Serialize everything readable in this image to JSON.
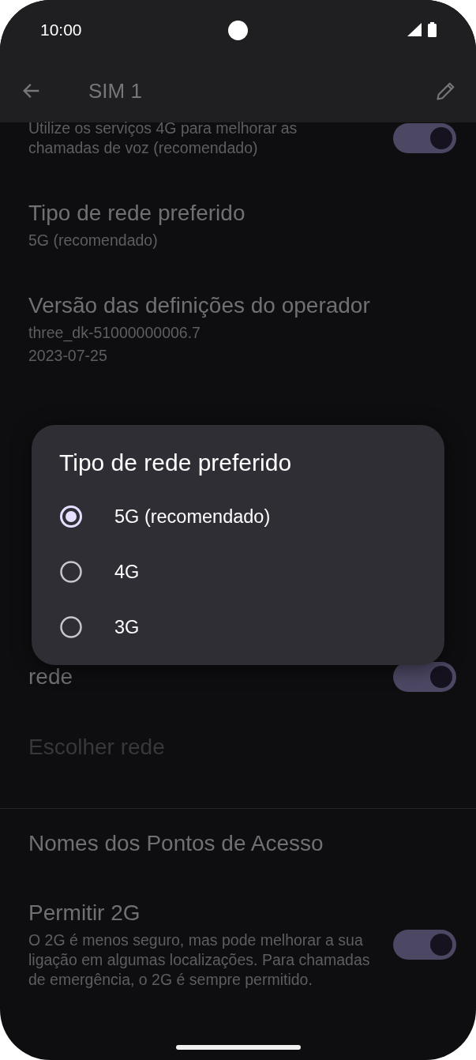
{
  "status_bar": {
    "time": "10:00"
  },
  "app_bar": {
    "title": "SIM 1"
  },
  "settings_above": [
    {
      "kind": "switch",
      "summary": [
        "Utilize os serviços 4G para melhorar as chamadas de voz (recomendado)"
      ],
      "on": true,
      "disabled": false
    },
    {
      "kind": "text",
      "title": "Tipo de rede preferido",
      "summary": [
        "5G (recomendado)"
      ],
      "disabled": false
    },
    {
      "kind": "text",
      "title": "Versão das definições do operador",
      "summary": [
        "three_dk-51000000006.7",
        "2023-07-25"
      ],
      "disabled": false
    }
  ],
  "settings_below": [
    {
      "kind": "switch",
      "title": "rede",
      "on": true,
      "disabled": false
    },
    {
      "kind": "text",
      "title": "Escolher rede",
      "disabled": true
    },
    {
      "kind": "divider"
    },
    {
      "kind": "text",
      "title": "Nomes dos Pontos de Acesso",
      "disabled": false
    },
    {
      "kind": "switch",
      "title": "Permitir 2G",
      "summary": [
        "O 2G é menos seguro, mas pode melhorar a sua ligação em algumas localizações. Para chamadas de emergência, o 2G é sempre permitido."
      ],
      "on": true,
      "disabled": false
    }
  ],
  "dialog": {
    "title": "Tipo de rede preferido",
    "options": [
      {
        "label": "5G (recomendado)",
        "selected": true
      },
      {
        "label": "4G",
        "selected": false
      },
      {
        "label": "3G",
        "selected": false
      }
    ]
  }
}
